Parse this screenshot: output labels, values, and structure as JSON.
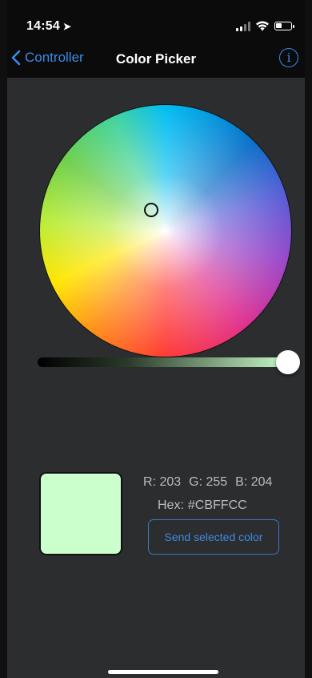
{
  "status_bar": {
    "time": "14:54",
    "icons": [
      "location-arrow-icon",
      "cellular-signal-icon",
      "wifi-icon",
      "battery-icon"
    ]
  },
  "nav": {
    "back_label": "Controller",
    "title": "Color Picker",
    "info_glyph": "i"
  },
  "picker": {
    "selected_hex": "#CBFFCC",
    "brightness": 1.0
  },
  "readout": {
    "r": "R: 203",
    "g": "G: 255",
    "b": "B: 204",
    "hex_label": "Hex:",
    "hex_value": "#CBFFCC"
  },
  "actions": {
    "send_label": "Send selected color"
  },
  "colors": {
    "accent": "#3b8ae5",
    "background": "#2c2d2f",
    "swatch": "#cbffcc"
  }
}
